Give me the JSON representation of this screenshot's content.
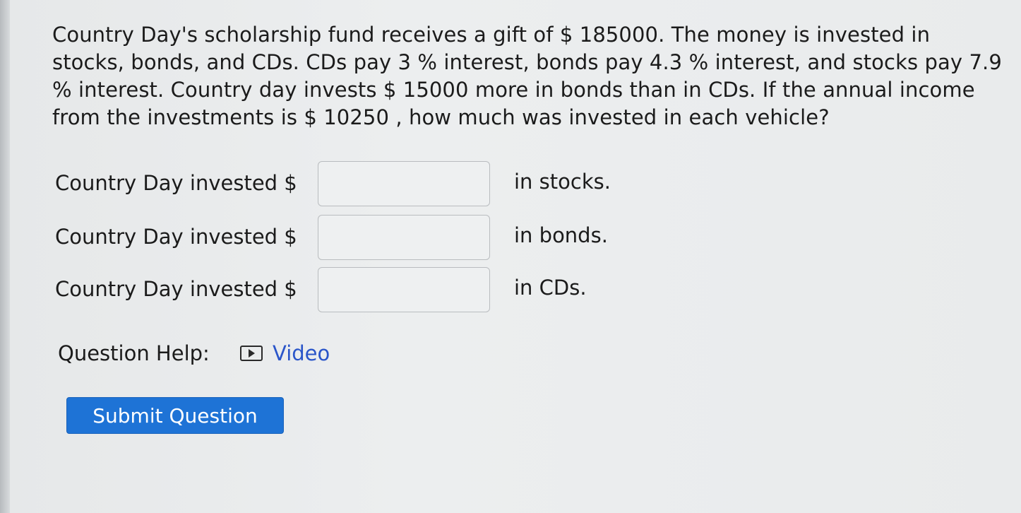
{
  "question": {
    "text": "Country Day's scholarship fund receives a gift of $ 185000. The money is invested in stocks, bonds, and CDs. CDs pay 3 % interest, bonds pay 4.3 % interest, and stocks pay 7.9 % interest. Country day invests $ 15000 more in bonds than in CDs. If the annual income from the investments is $ 10250 , how much was invested in each vehicle?"
  },
  "answers": [
    {
      "prefix": "Country Day invested $",
      "value": "",
      "suffix": "in stocks."
    },
    {
      "prefix": "Country Day invested $",
      "value": "",
      "suffix": "in bonds."
    },
    {
      "prefix": "Country Day invested $",
      "value": "",
      "suffix": "in CDs."
    }
  ],
  "help": {
    "label": "Question Help:",
    "icon": "video-icon",
    "video_label": "Video"
  },
  "submit": {
    "label": "Submit Question"
  },
  "colors": {
    "background": "#e9ebec",
    "link": "#2a55c9",
    "button": "#1e73d6",
    "button_text": "#ffffff"
  }
}
